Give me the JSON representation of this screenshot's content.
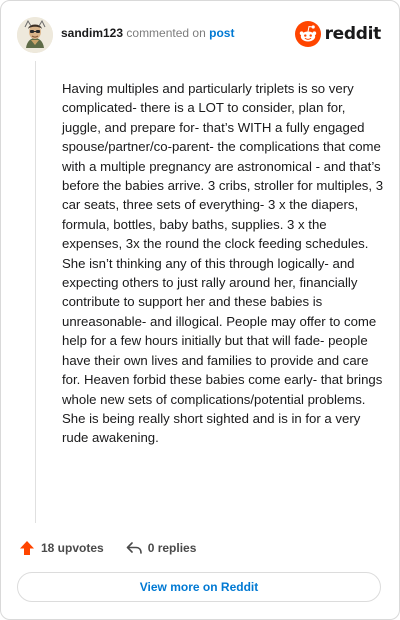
{
  "comment": {
    "username": "sandim123",
    "action_text": "commented on",
    "post_link": "post",
    "body": "Having multiples and particularly triplets is so very complicated- there is a LOT to consider, plan for, juggle, and prepare for- that’s WITH a fully engaged spouse/partner/co-parent- the complications that come with a multiple pregnancy are astronomical - and that’s before the babies arrive. 3 cribs, stroller for multiples, 3 car seats, three sets of everything- 3 x the diapers, formula, bottles, baby baths, supplies. 3 x the expenses, 3x the round the clock feeding schedules. She isn’t thinking any of this through logically- and expecting others to just rally around her, financially contribute to support her and these babies is unreasonable- and illogical. People may offer to come help for a few hours initially but that will fade- people have their own lives and families to provide and care for. Heaven forbid these babies come early- that brings whole new sets of complications/potential problems. She is being really short sighted and is in for a very rude awakening.",
    "upvotes": "18 upvotes",
    "replies": "0 replies"
  },
  "brand": {
    "name": "reddit",
    "logo_icon": "reddit-snoo-icon",
    "accent": "#ff4500"
  },
  "footer": {
    "view_more_label": "View more on Reddit"
  },
  "colors": {
    "link": "#0079d3",
    "upvote": "#ff4500",
    "muted": "#7c7c7c"
  }
}
